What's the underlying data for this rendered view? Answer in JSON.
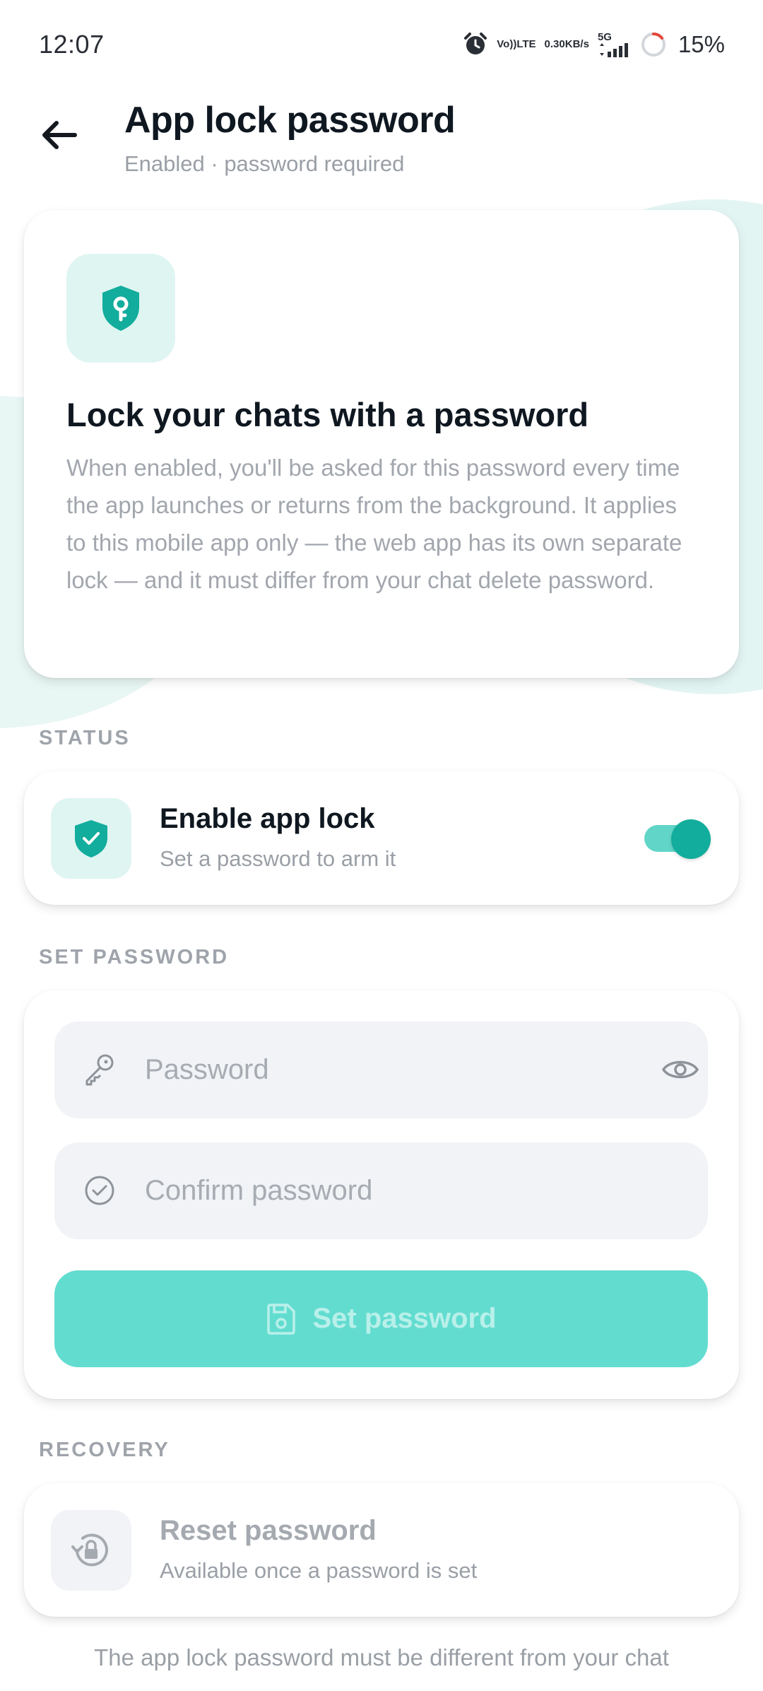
{
  "status_bar": {
    "time": "12:07",
    "volte_top": "Vo))",
    "volte_bottom": "LTE",
    "speed_value": "0.30",
    "speed_unit": "KB/s",
    "network": "5G",
    "battery": "15%"
  },
  "header": {
    "title": "App lock password",
    "subtitle": "Enabled · password required"
  },
  "hero": {
    "title": "Lock your chats with a password",
    "description": "When enabled, you'll be asked for this password every time the app launches or returns from the background. It applies to this mobile app only — the web app has its own separate lock — and it must differ from your chat delete password."
  },
  "status_section": {
    "label": "STATUS",
    "title": "Enable app lock",
    "subtitle": "Set a password to arm it",
    "enabled": true
  },
  "password_section": {
    "label": "SET PASSWORD",
    "password_placeholder": "Password",
    "confirm_placeholder": "Confirm password",
    "button_label": "Set password"
  },
  "recovery_section": {
    "label": "RECOVERY",
    "title": "Reset password",
    "subtitle": "Available once a password is set"
  },
  "bottom_note": "The app lock password must be different from your chat",
  "colors": {
    "accent": "#12ad9c",
    "accent_light": "#63dcd0",
    "icon_bg": "#dff5f2"
  }
}
